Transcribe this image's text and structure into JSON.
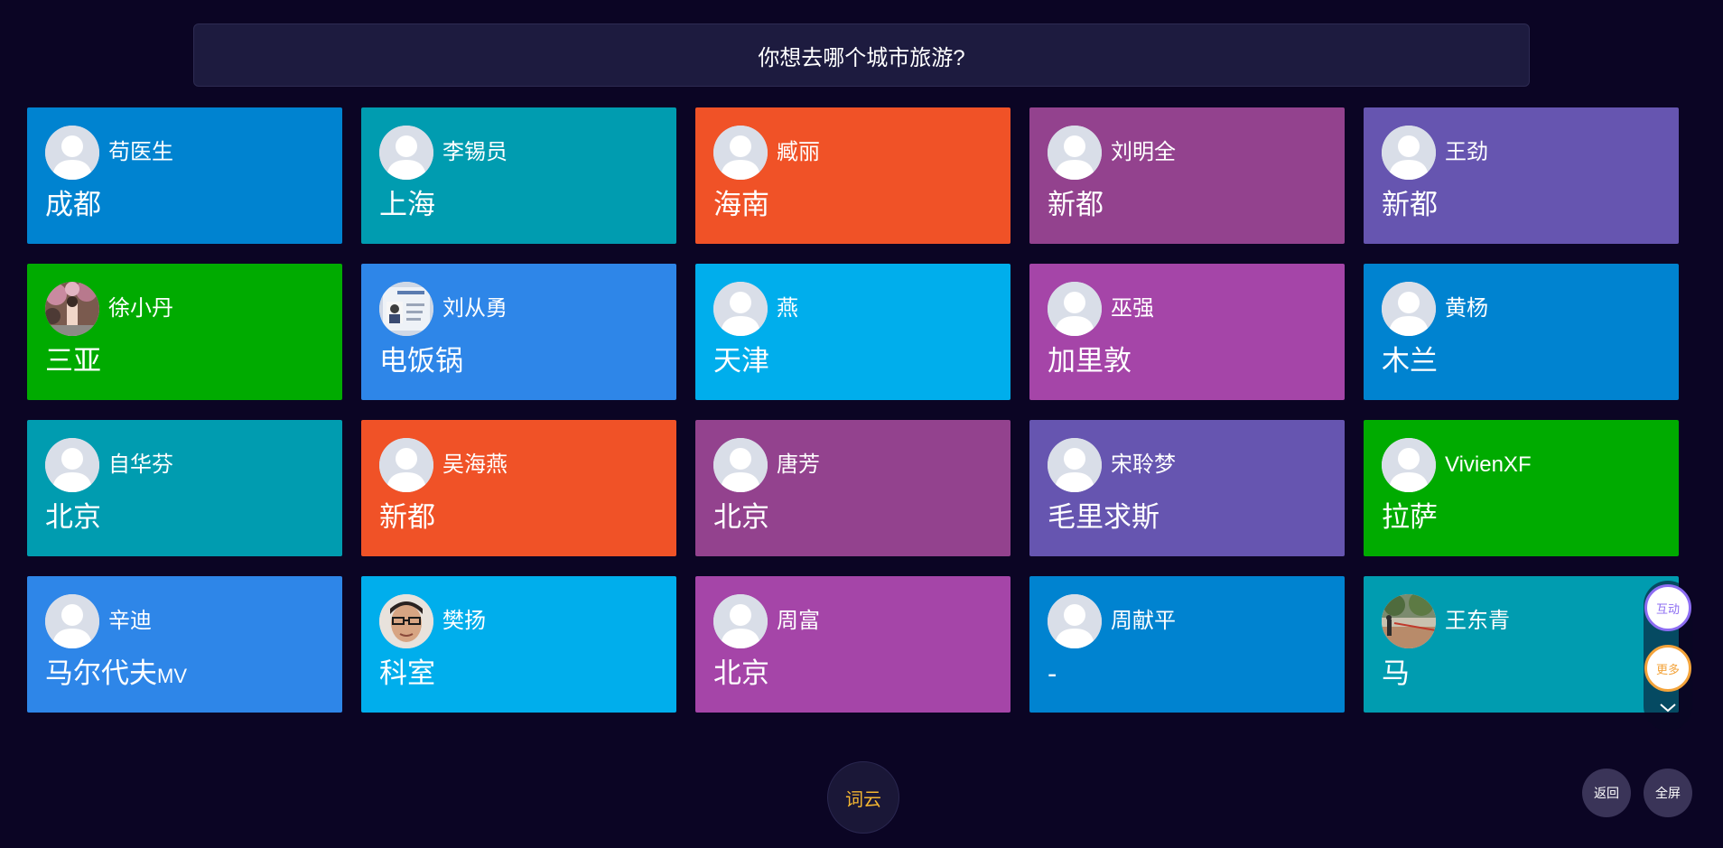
{
  "question": "你想去哪个城市旅游?",
  "colors": {
    "background": "#0b0524",
    "question_bg": "#1d1b3f",
    "wordcloud_text": "#f5b731"
  },
  "cards": [
    {
      "name": "苟医生",
      "answer": "成都",
      "color": "#0083d0",
      "avatar": "default-avatar"
    },
    {
      "name": "李锡员",
      "answer": "上海",
      "color": "#009cb0",
      "avatar": "default-avatar"
    },
    {
      "name": "臧丽",
      "answer": "海南",
      "color": "#f05227",
      "avatar": "default-avatar"
    },
    {
      "name": "刘明全",
      "answer": "新都",
      "color": "#93428e",
      "avatar": "default-avatar"
    },
    {
      "name": "王劲",
      "answer": "新都",
      "color": "#6655b0",
      "avatar": "default-avatar"
    },
    {
      "name": "徐小丹",
      "answer": "三亚",
      "color": "#00ab00",
      "avatar": "photo-avatar"
    },
    {
      "name": "刘从勇",
      "answer": "电饭锅",
      "color": "#2e86e8",
      "avatar": "id-card-avatar"
    },
    {
      "name": "燕",
      "answer": "天津",
      "color": "#00aeec",
      "avatar": "default-avatar"
    },
    {
      "name": "巫强",
      "answer": "加里敦",
      "color": "#a545a8",
      "avatar": "default-avatar"
    },
    {
      "name": "黄杨",
      "answer": "木兰",
      "color": "#0083d0",
      "avatar": "default-avatar"
    },
    {
      "name": "自华芬",
      "answer": "北京",
      "color": "#009cb0",
      "avatar": "default-avatar"
    },
    {
      "name": "吴海燕",
      "answer": "新都",
      "color": "#f05227",
      "avatar": "default-avatar"
    },
    {
      "name": "唐芳",
      "answer": "北京",
      "color": "#93428e",
      "avatar": "default-avatar"
    },
    {
      "name": "宋聆梦",
      "answer": "毛里求斯",
      "color": "#6655b0",
      "avatar": "default-avatar"
    },
    {
      "name": "VivienXF",
      "answer": "拉萨",
      "color": "#00ab00",
      "avatar": "default-avatar"
    },
    {
      "name": "辛迪",
      "answer": "马尔代夫",
      "answer_suffix": "MV",
      "color": "#2e86e8",
      "avatar": "default-avatar"
    },
    {
      "name": "樊扬",
      "answer": "科室",
      "color": "#00aeec",
      "avatar": "face-photo-avatar"
    },
    {
      "name": "周富",
      "answer": "北京",
      "color": "#a545a8",
      "avatar": "default-avatar"
    },
    {
      "name": "周献平",
      "answer": "-",
      "color": "#0083d0",
      "avatar": "default-avatar"
    },
    {
      "name": "王东青",
      "answer": "马",
      "color": "#009cb0",
      "avatar": "outdoor-photo-avatar"
    }
  ],
  "buttons": {
    "wordcloud": "词云",
    "back": "返回",
    "fullscreen": "全屏",
    "interact": "互动",
    "more": "更多"
  }
}
